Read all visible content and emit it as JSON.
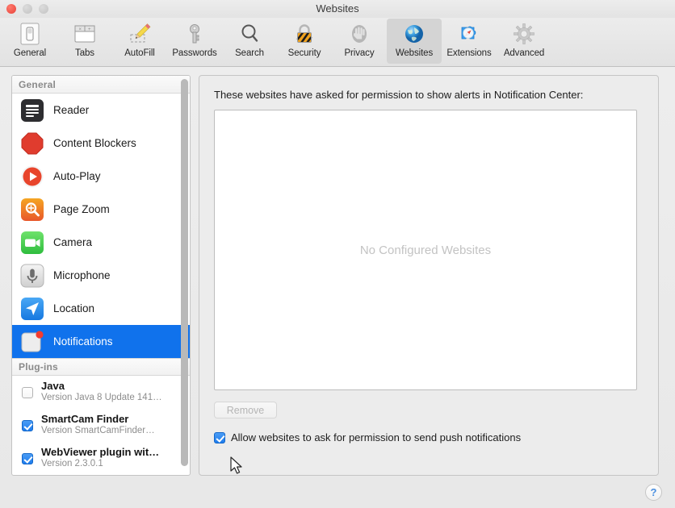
{
  "window": {
    "title": "Websites",
    "traffic_lights": [
      "close",
      "minimize",
      "maximize"
    ]
  },
  "toolbar": {
    "items": [
      {
        "label": "General",
        "icon": "general-switch-icon",
        "selected": false
      },
      {
        "label": "Tabs",
        "icon": "tabs-icon",
        "selected": false
      },
      {
        "label": "AutoFill",
        "icon": "autofill-pencil-icon",
        "selected": false
      },
      {
        "label": "Passwords",
        "icon": "key-icon",
        "selected": false
      },
      {
        "label": "Search",
        "icon": "magnifier-icon",
        "selected": false
      },
      {
        "label": "Security",
        "icon": "padlock-icon",
        "selected": false
      },
      {
        "label": "Privacy",
        "icon": "hand-icon",
        "selected": false
      },
      {
        "label": "Websites",
        "icon": "globe-icon",
        "selected": true
      },
      {
        "label": "Extensions",
        "icon": "puzzle-compass-icon",
        "selected": false
      },
      {
        "label": "Advanced",
        "icon": "gear-icon",
        "selected": false
      }
    ]
  },
  "sidebar": {
    "groups": [
      {
        "header": "General",
        "items": [
          {
            "label": "Reader",
            "icon": "reader-icon",
            "selected": false
          },
          {
            "label": "Content Blockers",
            "icon": "content-blockers-icon",
            "selected": false
          },
          {
            "label": "Auto-Play",
            "icon": "auto-play-icon",
            "selected": false
          },
          {
            "label": "Page Zoom",
            "icon": "page-zoom-icon",
            "selected": false
          },
          {
            "label": "Camera",
            "icon": "camera-icon",
            "selected": false
          },
          {
            "label": "Microphone",
            "icon": "microphone-icon",
            "selected": false
          },
          {
            "label": "Location",
            "icon": "location-icon",
            "selected": false
          },
          {
            "label": "Notifications",
            "icon": "notifications-icon",
            "selected": true
          }
        ]
      },
      {
        "header": "Plug-ins",
        "plugins": [
          {
            "name": "Java",
            "version": "Version Java 8 Update 141…",
            "checked": false
          },
          {
            "name": "SmartCam Finder",
            "version": "Version SmartCamFinder…",
            "checked": true
          },
          {
            "name": "WebViewer plugin wit…",
            "version": "Version 2.3.0.1",
            "checked": true
          }
        ]
      }
    ],
    "scrollbar": "sidebar-scrollbar"
  },
  "main": {
    "caption": "These websites have asked for permission to show alerts in Notification Center:",
    "empty_state": "No Configured Websites",
    "remove_button": "Remove",
    "remove_button_enabled": false,
    "allow_checkbox_label": "Allow websites to ask for permission to send push notifications",
    "allow_checkbox_checked": true
  },
  "help": {
    "label": "?"
  },
  "colors": {
    "selection_blue": "#1072ec",
    "checkbox_blue": "#1e7ced",
    "window_bg": "#ececec",
    "list_bg": "#ffffff",
    "empty_text": "#c3c3c3"
  }
}
